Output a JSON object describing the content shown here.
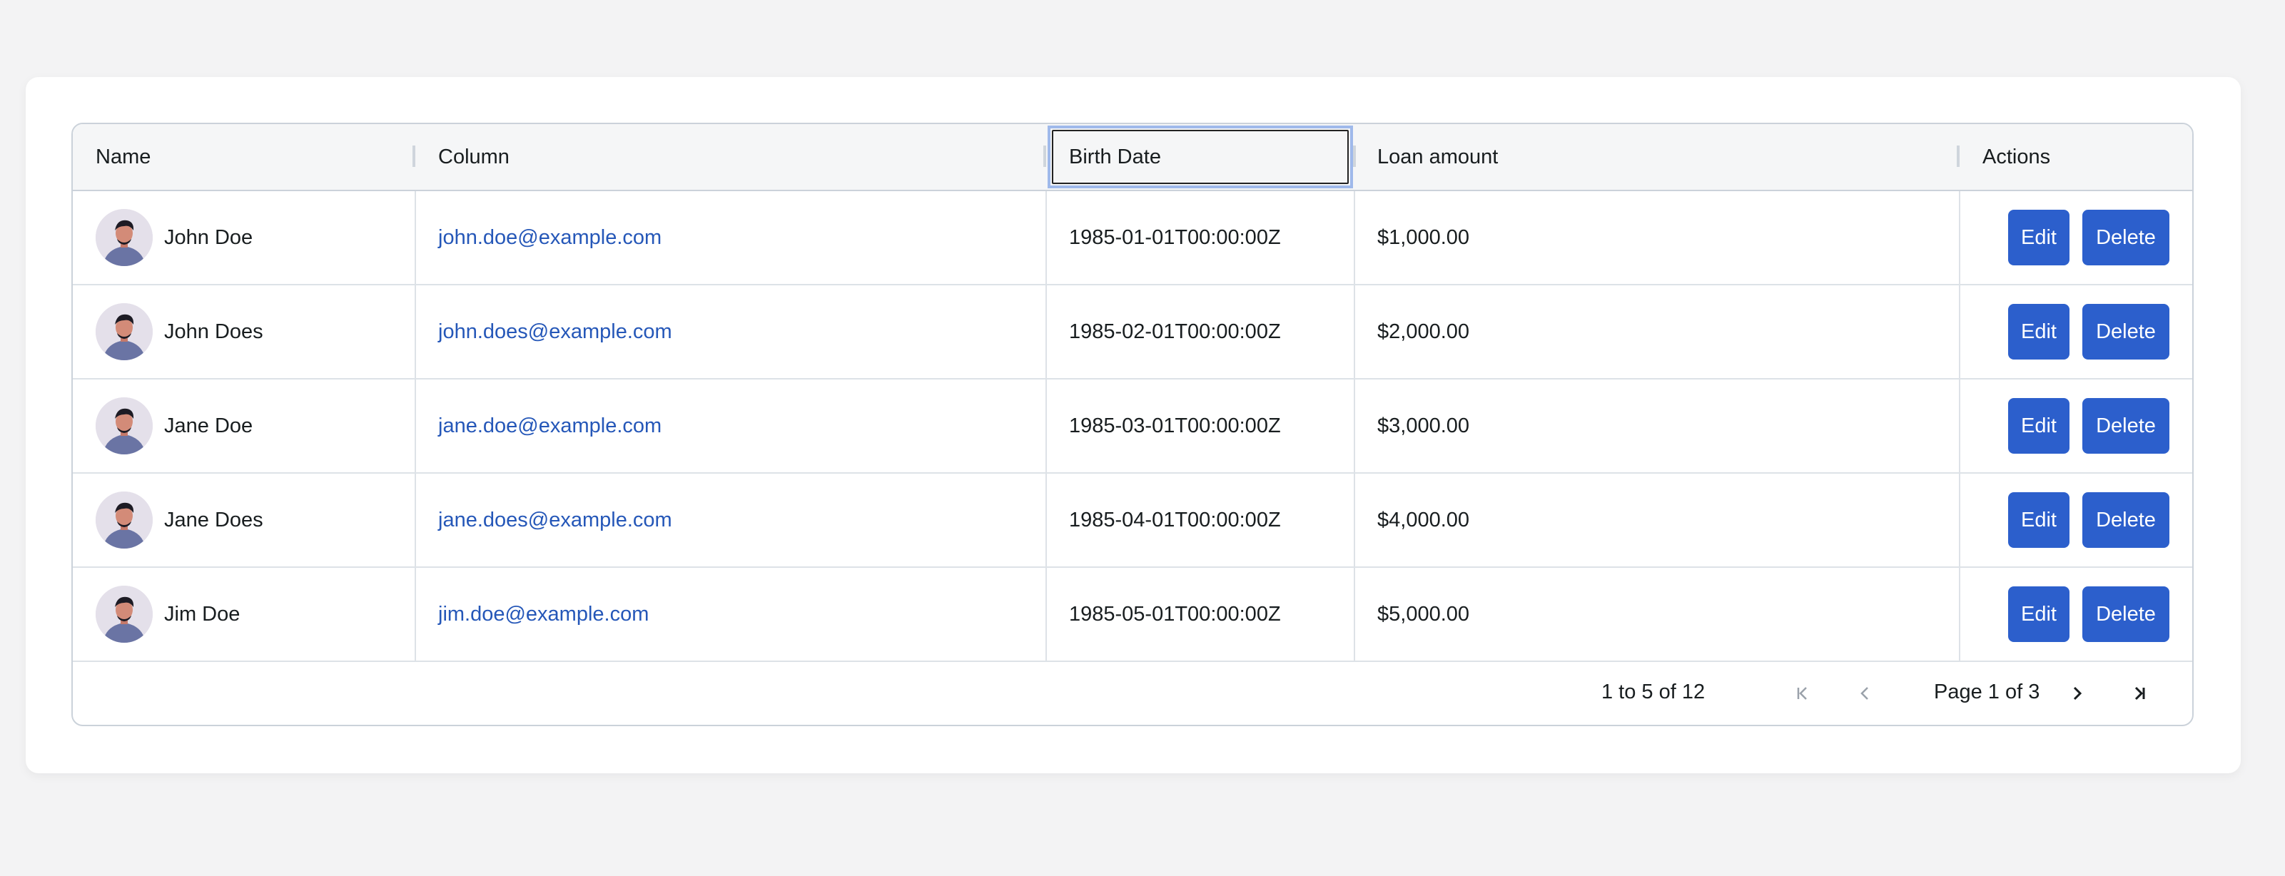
{
  "columns": {
    "name": "Name",
    "email": "Column",
    "birth": "Birth Date",
    "loan": "Loan amount",
    "actions": "Actions"
  },
  "rows": [
    {
      "name": "John Doe",
      "email": "john.doe@example.com",
      "birth": "1985-01-01T00:00:00Z",
      "loan": "$1,000.00"
    },
    {
      "name": "John Does",
      "email": "john.does@example.com",
      "birth": "1985-02-01T00:00:00Z",
      "loan": "$2,000.00"
    },
    {
      "name": "Jane Doe",
      "email": "jane.doe@example.com",
      "birth": "1985-03-01T00:00:00Z",
      "loan": "$3,000.00"
    },
    {
      "name": "Jane Does",
      "email": "jane.does@example.com",
      "birth": "1985-04-01T00:00:00Z",
      "loan": "$4,000.00"
    },
    {
      "name": "Jim Doe",
      "email": "jim.doe@example.com",
      "birth": "1985-05-01T00:00:00Z",
      "loan": "$5,000.00"
    }
  ],
  "buttons": {
    "edit": "Edit",
    "delete": "Delete"
  },
  "pagination": {
    "summary": "1 to 5 of 12",
    "page_label": "Page 1 of 3",
    "icons": [
      "first-page-icon",
      "previous-page-icon",
      "next-page-icon",
      "last-page-icon"
    ]
  },
  "colors": {
    "accent": "#2c5fcc",
    "link": "#2557b8",
    "header_bg": "#f5f6f7",
    "border": "#cbd2da"
  }
}
